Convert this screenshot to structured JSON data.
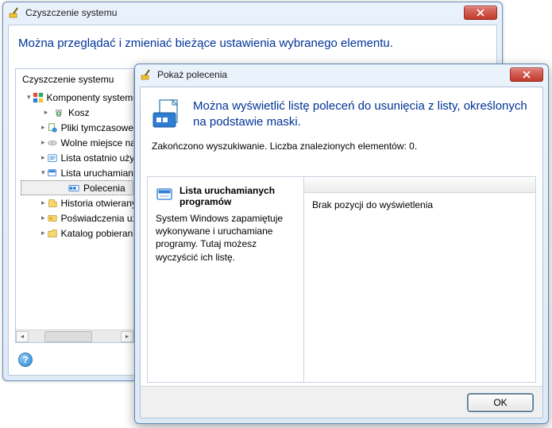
{
  "back": {
    "title": "Czyszczenie systemu",
    "heading": "Można przeglądać i zmieniać bieżące ustawienia wybranego elementu.",
    "tree_title": "Czyszczenie systemu",
    "root_label": "Komponenty systemowe",
    "nodes": {
      "kosz": "Kosz",
      "pliki": "Pliki tymczasowe",
      "wolne": "Wolne miejsce na dysku",
      "lista_ost": "Lista ostatnio używanych",
      "lista_uru": "Lista uruchamianych",
      "polecenia": "Polecenia",
      "historia": "Historia otwieranych",
      "posw": "Poświadczenia użytkownika",
      "katalog": "Katalog pobierania"
    }
  },
  "front": {
    "title": "Pokaż polecenia",
    "heading": "Można wyświetlić listę poleceń do usunięcia z listy, określonych na podstawie maski.",
    "result": "Zakończono wyszukiwanie. Liczba znalezionych elementów: 0.",
    "left_title": "Lista uruchamianych programów",
    "left_desc": "System Windows zapamiętuje wykonywane i uruchamiane programy. Tutaj możesz wyczyścić ich listę.",
    "right_empty": "Brak pozycji do wyświetlenia",
    "ok": "OK"
  }
}
